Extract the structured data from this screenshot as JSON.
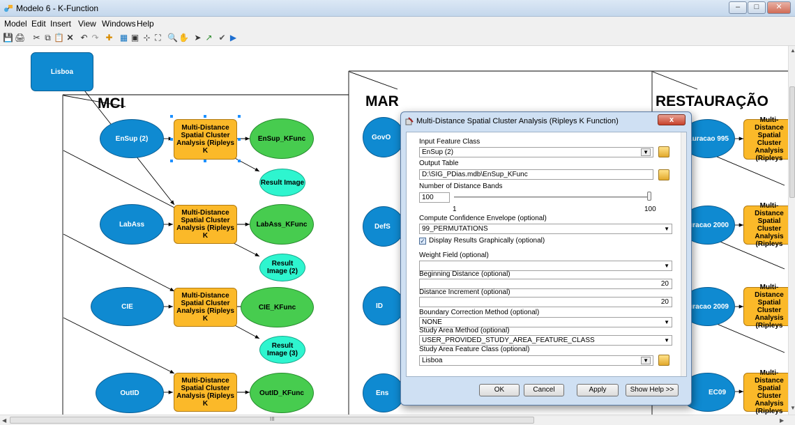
{
  "window": {
    "title": "Modelo 6 - K-Function"
  },
  "menu": [
    "Model",
    "Edit",
    "Insert",
    "View",
    "Windows",
    "Help"
  ],
  "canvas": {
    "root_node": "Lisboa",
    "sections": [
      "MCI",
      "MAR",
      "RESTAURAÇÃO"
    ],
    "mci_rows": [
      {
        "input": "EnSup (2)",
        "tool": "Multi-Distance Spatial Cluster Analysis (Ripleys K",
        "output": "EnSup_KFunc",
        "image": "Result Image"
      },
      {
        "input": "LabAss",
        "tool": "Multi-Distance Spatial Cluster Analysis (Ripleys K",
        "output": "LabAss_KFunc",
        "image": "Result Image (2)"
      },
      {
        "input": "CIE",
        "tool": "Multi-Distance Spatial Cluster Analysis (Ripleys K",
        "output": "CIE_KFunc",
        "image": "Result Image (3)"
      },
      {
        "input": "OutID",
        "tool": "Multi-Distance Spatial Cluster Analysis (Ripleys K",
        "output": "OutID_KFunc"
      }
    ],
    "mar_inputs": [
      "GovO",
      "DefS",
      "ID",
      "Ens"
    ],
    "rest_inputs": [
      "auracao 995",
      "auracao 2000",
      "auracao 2009",
      "EC09"
    ],
    "rest_tool_label": "Multi-Distance Spatial Cluster Analysis (Ripleys"
  },
  "dialog": {
    "title": "Multi-Distance Spatial Cluster Analysis (Ripleys K Function)",
    "close": "x",
    "fields": {
      "input_feature_class": {
        "label": "Input Feature Class",
        "value": "EnSup (2)"
      },
      "output_table": {
        "label": "Output Table",
        "value": "D:\\SIG_PDias.mdb\\EnSup_KFunc"
      },
      "num_bands": {
        "label": "Number of Distance Bands",
        "value": "100",
        "min": "1",
        "max": "100"
      },
      "confidence": {
        "label": "Compute Confidence Envelope (optional)",
        "value": "99_PERMUTATIONS"
      },
      "display": {
        "label": "Display Results Graphically (optional)",
        "checked": true
      },
      "weight": {
        "label": "Weight Field (optional)",
        "value": ""
      },
      "begin_dist": {
        "label": "Beginning Distance (optional)",
        "value": "20"
      },
      "dist_inc": {
        "label": "Distance Increment (optional)",
        "value": "20"
      },
      "boundary": {
        "label": "Boundary Correction Method (optional)",
        "value": "NONE"
      },
      "study_method": {
        "label": "Study Area Method (optional)",
        "value": "USER_PROVIDED_STUDY_AREA_FEATURE_CLASS"
      },
      "study_fc": {
        "label": "Study Area Feature Class (optional)",
        "value": "Lisboa"
      }
    },
    "buttons": {
      "ok": "OK",
      "cancel": "Cancel",
      "apply": "Apply",
      "help": "Show Help >>"
    }
  },
  "scrollbar": {
    "grip": "III"
  }
}
